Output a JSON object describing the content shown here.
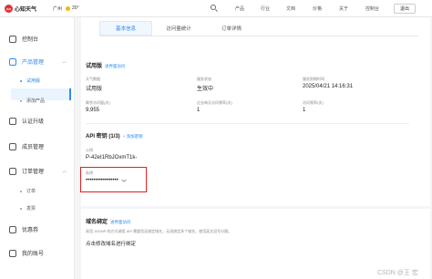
{
  "topbar": {
    "brand": "心知天气",
    "city": "广州",
    "temp": "20°",
    "nav": [
      "产品",
      "行业",
      "文档",
      "价格",
      "关于",
      "控制台"
    ],
    "login": "退出"
  },
  "sidebar": {
    "console": "控制台",
    "product_mgmt": "产品管理",
    "trial": "试用版",
    "add_product": "添加产品",
    "upgrade": "认证升级",
    "members": "成员管理",
    "orders": "订单管理",
    "order": "订单",
    "invoice": "发票",
    "coupon": "优惠券",
    "account": "我的账号"
  },
  "tabs": [
    "基本信息",
    "访问量统计",
    "订单详情"
  ],
  "product": {
    "title": "试用版",
    "link": "进界面访问",
    "l1": "天气数据",
    "v1": "试用版",
    "l2": "服务状态",
    "v2": "生效中",
    "l3": "服务到期时间",
    "v3": "2025/04/21 14:16:31",
    "l4": "剩余访问量(次)",
    "v4": "9,955",
    "l5": "过去每天访问频率(次)",
    "v5": "1",
    "l6": "访问频率(次)",
    "v6": "1"
  },
  "api": {
    "title": "API 密钥 (1/3)",
    "add": "+ 添加密钥",
    "pub_label": "公钥",
    "pub_value": "P-42eI1RbJOxmT1k-",
    "priv_label": "私钥",
    "priv_value": "•••••••••••••••••"
  },
  "domain": {
    "title": "域名绑定",
    "link": "进界面访问",
    "desc": "采用 JSONP 的方式调用 API 需要验证绑定域名，无须绑定多个域名，使用英文逗号分隔。",
    "action": "点击修改域名进行绑定"
  },
  "watermark": "CSDN @王 宏"
}
